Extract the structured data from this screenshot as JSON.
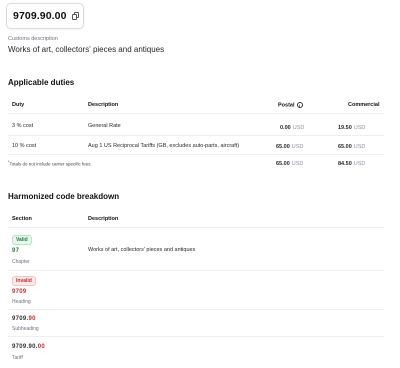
{
  "header": {
    "code": "9709.90.00",
    "copy_icon": "copy-icon",
    "customs_label": "Customs description",
    "customs_description": "Works of art, collectors' pieces and antiques"
  },
  "duties": {
    "title": "Applicable duties",
    "columns": {
      "duty": "Duty",
      "description": "Description",
      "postal": "Postal",
      "commercial": "Commercial"
    },
    "info_icon": "i",
    "rows": [
      {
        "duty": "3 % cost",
        "description": "General Rate",
        "postal_value": "0.00",
        "postal_unit": "USD",
        "commercial_value": "19.50",
        "commercial_unit": "USD"
      },
      {
        "duty": "10 % cost",
        "description": "Aug 1 US Reciprocal Tariffs (GB, excludes auto-parts, aircraft)",
        "postal_value": "65.00",
        "postal_unit": "USD",
        "commercial_value": "65.00",
        "commercial_unit": "USD"
      }
    ],
    "totals": {
      "footnote_mark": "*",
      "footnote": "Totals do not include carrier specific fees.",
      "postal_value": "65.00",
      "postal_unit": "USD",
      "commercial_value": "84.50",
      "commercial_unit": "USD"
    }
  },
  "breakdown": {
    "title": "Harmonized code breakdown",
    "columns": {
      "section": "Section",
      "description": "Description"
    },
    "rows": [
      {
        "badge": "Valid",
        "code_main": "97",
        "code_highlight": "",
        "level": "Chapter",
        "description": "Works of art, collectors' pieces and antiques"
      },
      {
        "badge": "Invalid",
        "code_main": "9709",
        "code_highlight": "",
        "level": "Heading",
        "description": ""
      },
      {
        "badge": "",
        "code_main": "9709.",
        "code_highlight": "90",
        "level": "Subheading",
        "description": ""
      },
      {
        "badge": "",
        "code_main": "9709.90.",
        "code_highlight": "00",
        "level": "Tariff",
        "description": ""
      }
    ]
  },
  "colors": {
    "valid": "#1e7f3c",
    "invalid": "#c42b2b",
    "muted": "#6b7280"
  }
}
